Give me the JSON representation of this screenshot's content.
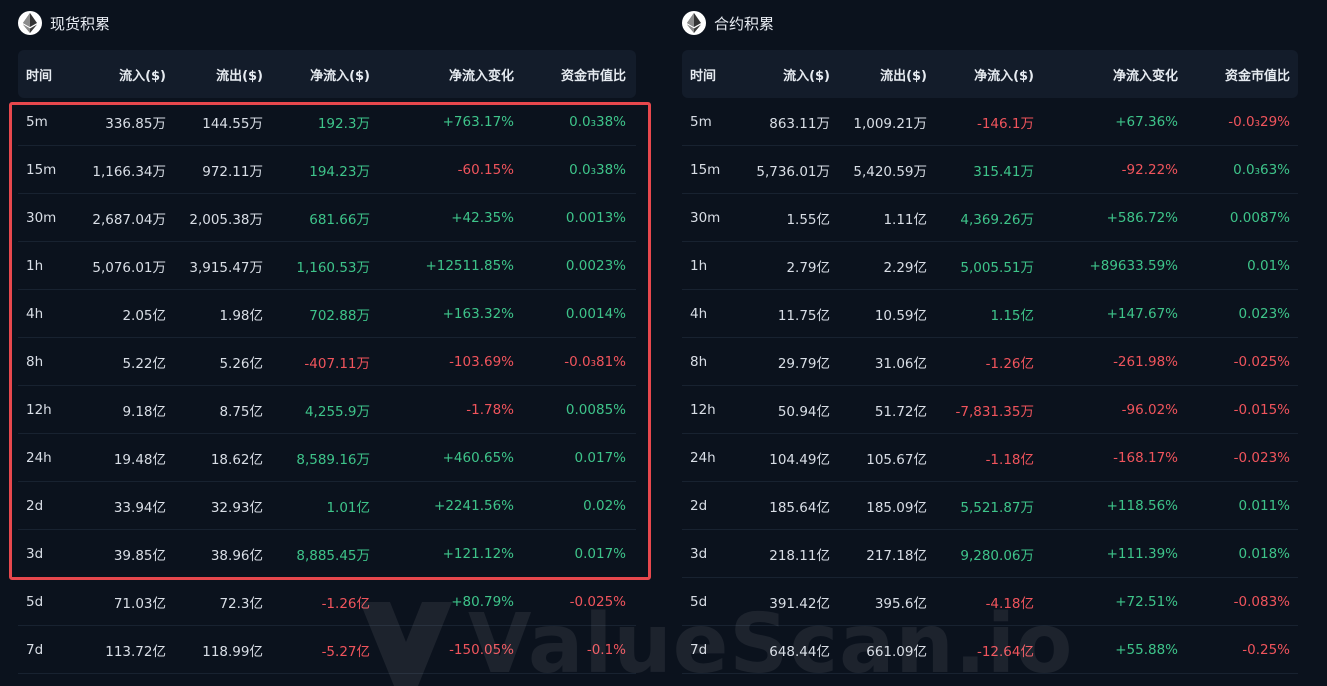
{
  "panels": [
    {
      "id": "spot",
      "title": "现货积累",
      "logo_icon": "ethereum-icon",
      "columns": [
        "时间",
        "流入($)",
        "流出($)",
        "净流入($)",
        "净流入变化",
        "资金市值比"
      ],
      "rows": [
        {
          "time": "5m",
          "inflow": "336.85万",
          "outflow": "144.55万",
          "net": "192.3万",
          "net_sign": "pos",
          "change": "+763.17%",
          "change_sign": "pos",
          "ratio": "0.0₃38%",
          "ratio_sign": "pos"
        },
        {
          "time": "15m",
          "inflow": "1,166.34万",
          "outflow": "972.11万",
          "net": "194.23万",
          "net_sign": "pos",
          "change": "-60.15%",
          "change_sign": "neg",
          "ratio": "0.0₃38%",
          "ratio_sign": "pos"
        },
        {
          "time": "30m",
          "inflow": "2,687.04万",
          "outflow": "2,005.38万",
          "net": "681.66万",
          "net_sign": "pos",
          "change": "+42.35%",
          "change_sign": "pos",
          "ratio": "0.0013%",
          "ratio_sign": "pos"
        },
        {
          "time": "1h",
          "inflow": "5,076.01万",
          "outflow": "3,915.47万",
          "net": "1,160.53万",
          "net_sign": "pos",
          "change": "+12511.85%",
          "change_sign": "pos",
          "ratio": "0.0023%",
          "ratio_sign": "pos"
        },
        {
          "time": "4h",
          "inflow": "2.05亿",
          "outflow": "1.98亿",
          "net": "702.88万",
          "net_sign": "pos",
          "change": "+163.32%",
          "change_sign": "pos",
          "ratio": "0.0014%",
          "ratio_sign": "pos"
        },
        {
          "time": "8h",
          "inflow": "5.22亿",
          "outflow": "5.26亿",
          "net": "-407.11万",
          "net_sign": "neg",
          "change": "-103.69%",
          "change_sign": "neg",
          "ratio": "-0.0₃81%",
          "ratio_sign": "neg"
        },
        {
          "time": "12h",
          "inflow": "9.18亿",
          "outflow": "8.75亿",
          "net": "4,255.9万",
          "net_sign": "pos",
          "change": "-1.78%",
          "change_sign": "neg",
          "ratio": "0.0085%",
          "ratio_sign": "pos"
        },
        {
          "time": "24h",
          "inflow": "19.48亿",
          "outflow": "18.62亿",
          "net": "8,589.16万",
          "net_sign": "pos",
          "change": "+460.65%",
          "change_sign": "pos",
          "ratio": "0.017%",
          "ratio_sign": "pos"
        },
        {
          "time": "2d",
          "inflow": "33.94亿",
          "outflow": "32.93亿",
          "net": "1.01亿",
          "net_sign": "pos",
          "change": "+2241.56%",
          "change_sign": "pos",
          "ratio": "0.02%",
          "ratio_sign": "pos"
        },
        {
          "time": "3d",
          "inflow": "39.85亿",
          "outflow": "38.96亿",
          "net": "8,885.45万",
          "net_sign": "pos",
          "change": "+121.12%",
          "change_sign": "pos",
          "ratio": "0.017%",
          "ratio_sign": "pos"
        },
        {
          "time": "5d",
          "inflow": "71.03亿",
          "outflow": "72.3亿",
          "net": "-1.26亿",
          "net_sign": "neg",
          "change": "+80.79%",
          "change_sign": "pos",
          "ratio": "-0.025%",
          "ratio_sign": "neg"
        },
        {
          "time": "7d",
          "inflow": "113.72亿",
          "outflow": "118.99亿",
          "net": "-5.27亿",
          "net_sign": "neg",
          "change": "-150.05%",
          "change_sign": "neg",
          "ratio": "-0.1%",
          "ratio_sign": "neg"
        }
      ]
    },
    {
      "id": "contract",
      "title": "合约积累",
      "logo_icon": "ethereum-icon",
      "columns": [
        "时间",
        "流入($)",
        "流出($)",
        "净流入($)",
        "净流入变化",
        "资金市值比"
      ],
      "rows": [
        {
          "time": "5m",
          "inflow": "863.11万",
          "outflow": "1,009.21万",
          "net": "-146.1万",
          "net_sign": "neg",
          "change": "+67.36%",
          "change_sign": "pos",
          "ratio": "-0.0₃29%",
          "ratio_sign": "neg"
        },
        {
          "time": "15m",
          "inflow": "5,736.01万",
          "outflow": "5,420.59万",
          "net": "315.41万",
          "net_sign": "pos",
          "change": "-92.22%",
          "change_sign": "neg",
          "ratio": "0.0₃63%",
          "ratio_sign": "pos"
        },
        {
          "time": "30m",
          "inflow": "1.55亿",
          "outflow": "1.11亿",
          "net": "4,369.26万",
          "net_sign": "pos",
          "change": "+586.72%",
          "change_sign": "pos",
          "ratio": "0.0087%",
          "ratio_sign": "pos"
        },
        {
          "time": "1h",
          "inflow": "2.79亿",
          "outflow": "2.29亿",
          "net": "5,005.51万",
          "net_sign": "pos",
          "change": "+89633.59%",
          "change_sign": "pos",
          "ratio": "0.01%",
          "ratio_sign": "pos"
        },
        {
          "time": "4h",
          "inflow": "11.75亿",
          "outflow": "10.59亿",
          "net": "1.15亿",
          "net_sign": "pos",
          "change": "+147.67%",
          "change_sign": "pos",
          "ratio": "0.023%",
          "ratio_sign": "pos"
        },
        {
          "time": "8h",
          "inflow": "29.79亿",
          "outflow": "31.06亿",
          "net": "-1.26亿",
          "net_sign": "neg",
          "change": "-261.98%",
          "change_sign": "neg",
          "ratio": "-0.025%",
          "ratio_sign": "neg"
        },
        {
          "time": "12h",
          "inflow": "50.94亿",
          "outflow": "51.72亿",
          "net": "-7,831.35万",
          "net_sign": "neg",
          "change": "-96.02%",
          "change_sign": "neg",
          "ratio": "-0.015%",
          "ratio_sign": "neg"
        },
        {
          "time": "24h",
          "inflow": "104.49亿",
          "outflow": "105.67亿",
          "net": "-1.18亿",
          "net_sign": "neg",
          "change": "-168.17%",
          "change_sign": "neg",
          "ratio": "-0.023%",
          "ratio_sign": "neg"
        },
        {
          "time": "2d",
          "inflow": "185.64亿",
          "outflow": "185.09亿",
          "net": "5,521.87万",
          "net_sign": "pos",
          "change": "+118.56%",
          "change_sign": "pos",
          "ratio": "0.011%",
          "ratio_sign": "pos"
        },
        {
          "time": "3d",
          "inflow": "218.11亿",
          "outflow": "217.18亿",
          "net": "9,280.06万",
          "net_sign": "pos",
          "change": "+111.39%",
          "change_sign": "pos",
          "ratio": "0.018%",
          "ratio_sign": "pos"
        },
        {
          "time": "5d",
          "inflow": "391.42亿",
          "outflow": "395.6亿",
          "net": "-4.18亿",
          "net_sign": "neg",
          "change": "+72.51%",
          "change_sign": "pos",
          "ratio": "-0.083%",
          "ratio_sign": "neg"
        },
        {
          "time": "7d",
          "inflow": "648.44亿",
          "outflow": "661.09亿",
          "net": "-12.64亿",
          "net_sign": "neg",
          "change": "+55.88%",
          "change_sign": "pos",
          "ratio": "-0.25%",
          "ratio_sign": "neg"
        }
      ]
    }
  ],
  "colors": {
    "background": "#0b121d",
    "header_bg": "#131c2a",
    "positive": "#3ec48a",
    "negative": "#f0545c",
    "highlight_border": "#e8484d"
  },
  "watermark": {
    "text": "ValueScan.io",
    "icon": "valuescan-logo-icon"
  }
}
